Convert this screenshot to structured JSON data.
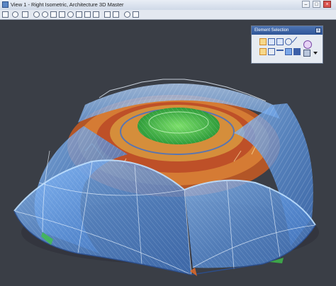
{
  "window": {
    "title": "View 1 - Right Isometric, Architecture 3D Master"
  },
  "palette": {
    "title": "Element Selection",
    "close_glyph": "x"
  },
  "toolbar": {
    "tools": [
      "view-attributes-icon",
      "view-display-mode-icon",
      "update-view-icon",
      "zoom-in-icon",
      "zoom-out-icon",
      "window-area-icon",
      "fit-view-icon",
      "rotate-view-icon",
      "pan-view-icon",
      "view-previous-icon",
      "view-next-icon",
      "camera-icon",
      "clip-volume-icon",
      "render-icon",
      "view-settings-icon"
    ]
  },
  "palette_tools": [
    "select-arrow-icon",
    "rectangle-select-icon",
    "shape-select-icon",
    "circle-select-icon",
    "line-select-icon",
    "add-mode-icon",
    "move-mode-icon",
    "subtract-mode-icon",
    "invert-mode-icon",
    "clear-selection-icon",
    "select-all-icon",
    "level-filter-icon",
    "dropdown-arrow-icon"
  ],
  "colors": {
    "background": "#3b3f47",
    "shell_blue": "#5b8fd6",
    "glass_green": "#3fbf4a",
    "interior_orange": "#d9682a",
    "palette_title": "#2f5597"
  }
}
